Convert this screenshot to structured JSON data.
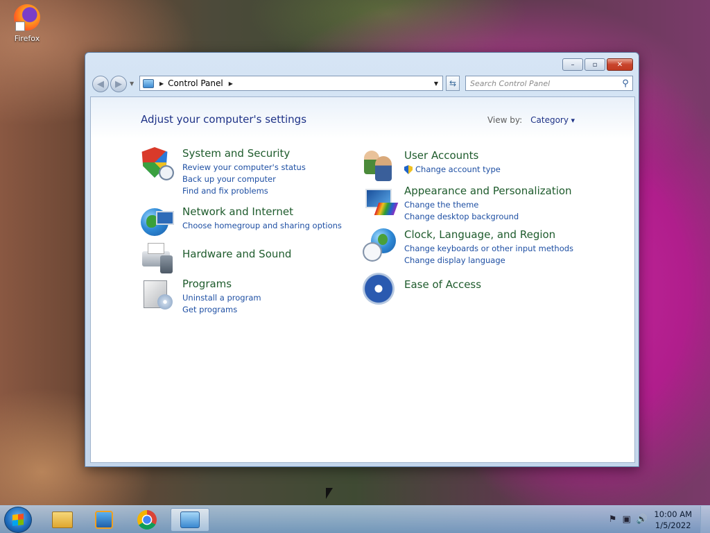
{
  "desktop": {
    "icons": [
      {
        "label": "Firefox",
        "icon": "firefox-icon"
      }
    ]
  },
  "window": {
    "controls": {
      "minimize": "–",
      "maximize": "▫",
      "close": "✕"
    },
    "nav": {
      "back": "◀",
      "forward": "▶"
    },
    "address": {
      "crumb": "Control Panel"
    },
    "search": {
      "placeholder": "Search Control Panel"
    }
  },
  "content": {
    "title": "Adjust your computer's settings",
    "view_by_label": "View by:",
    "view_by_value": "Category",
    "categories": [
      {
        "title": "System and Security",
        "icon": "shield-icon",
        "links": [
          "Review your computer's status",
          "Back up your computer",
          "Find and fix problems"
        ]
      },
      {
        "title": "Network and Internet",
        "icon": "network-globe-icon",
        "links": [
          "Choose homegroup and sharing options"
        ]
      },
      {
        "title": "Hardware and Sound",
        "icon": "printer-icon",
        "links": []
      },
      {
        "title": "Programs",
        "icon": "programs-box-icon",
        "links": [
          "Uninstall a program",
          "Get programs"
        ]
      },
      {
        "title": "User Accounts",
        "icon": "users-icon",
        "links": [
          "Change account type"
        ]
      },
      {
        "title": "Appearance and Personalization",
        "icon": "appearance-icon",
        "links": [
          "Change the theme",
          "Change desktop background"
        ]
      },
      {
        "title": "Clock, Language, and Region",
        "icon": "clock-globe-icon",
        "links": [
          "Change keyboards or other input methods",
          "Change display language"
        ]
      },
      {
        "title": "Ease of Access",
        "icon": "ease-of-access-icon",
        "links": []
      }
    ]
  },
  "taskbar": {
    "time": "10:00 AM",
    "date": "1/5/2022",
    "tray": {
      "network": "▣",
      "volume": "🔊",
      "flag": "⚑"
    }
  }
}
